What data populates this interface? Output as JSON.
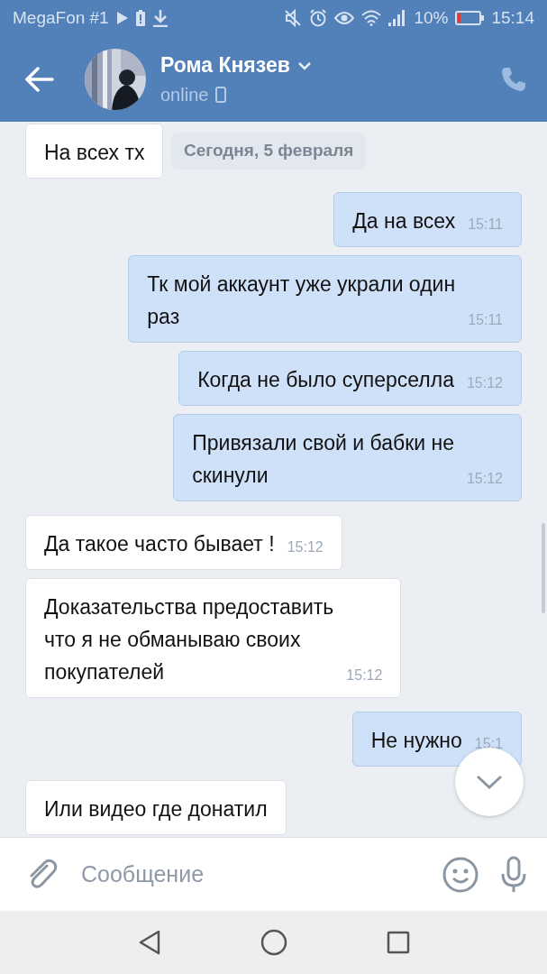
{
  "status_bar": {
    "carrier": "MegaFon #1",
    "battery": "10%",
    "time": "15:14"
  },
  "header": {
    "name": "Рома Князев",
    "status": "online"
  },
  "date_badge": "Сегодня, 5 февраля",
  "messages": [
    {
      "kind": "incoming",
      "text": "На всех тх"
    },
    {
      "kind": "outgoing",
      "text": "Да на всех",
      "time": "15:11"
    },
    {
      "kind": "outgoing",
      "text": "Тк мой аккаунт уже украли один\nраз",
      "time": "15:11"
    },
    {
      "kind": "outgoing",
      "text": "Когда не было суперселла",
      "time": "15:12"
    },
    {
      "kind": "outgoing",
      "text": "Привязали свой и бабки не\nскинули",
      "time": "15:12"
    },
    {
      "kind": "incoming",
      "text": "Да такое часто бывает !",
      "time": "15:12"
    },
    {
      "kind": "incoming",
      "text": "Доказательства предоставить\nчто я не обманываю своих\nпокупателей",
      "time": "15:12"
    },
    {
      "kind": "outgoing",
      "text": "Не нужно",
      "time": "15:1"
    },
    {
      "kind": "incoming",
      "text": "Или видео где донатил"
    }
  ],
  "composer": {
    "placeholder": "Сообщение"
  }
}
